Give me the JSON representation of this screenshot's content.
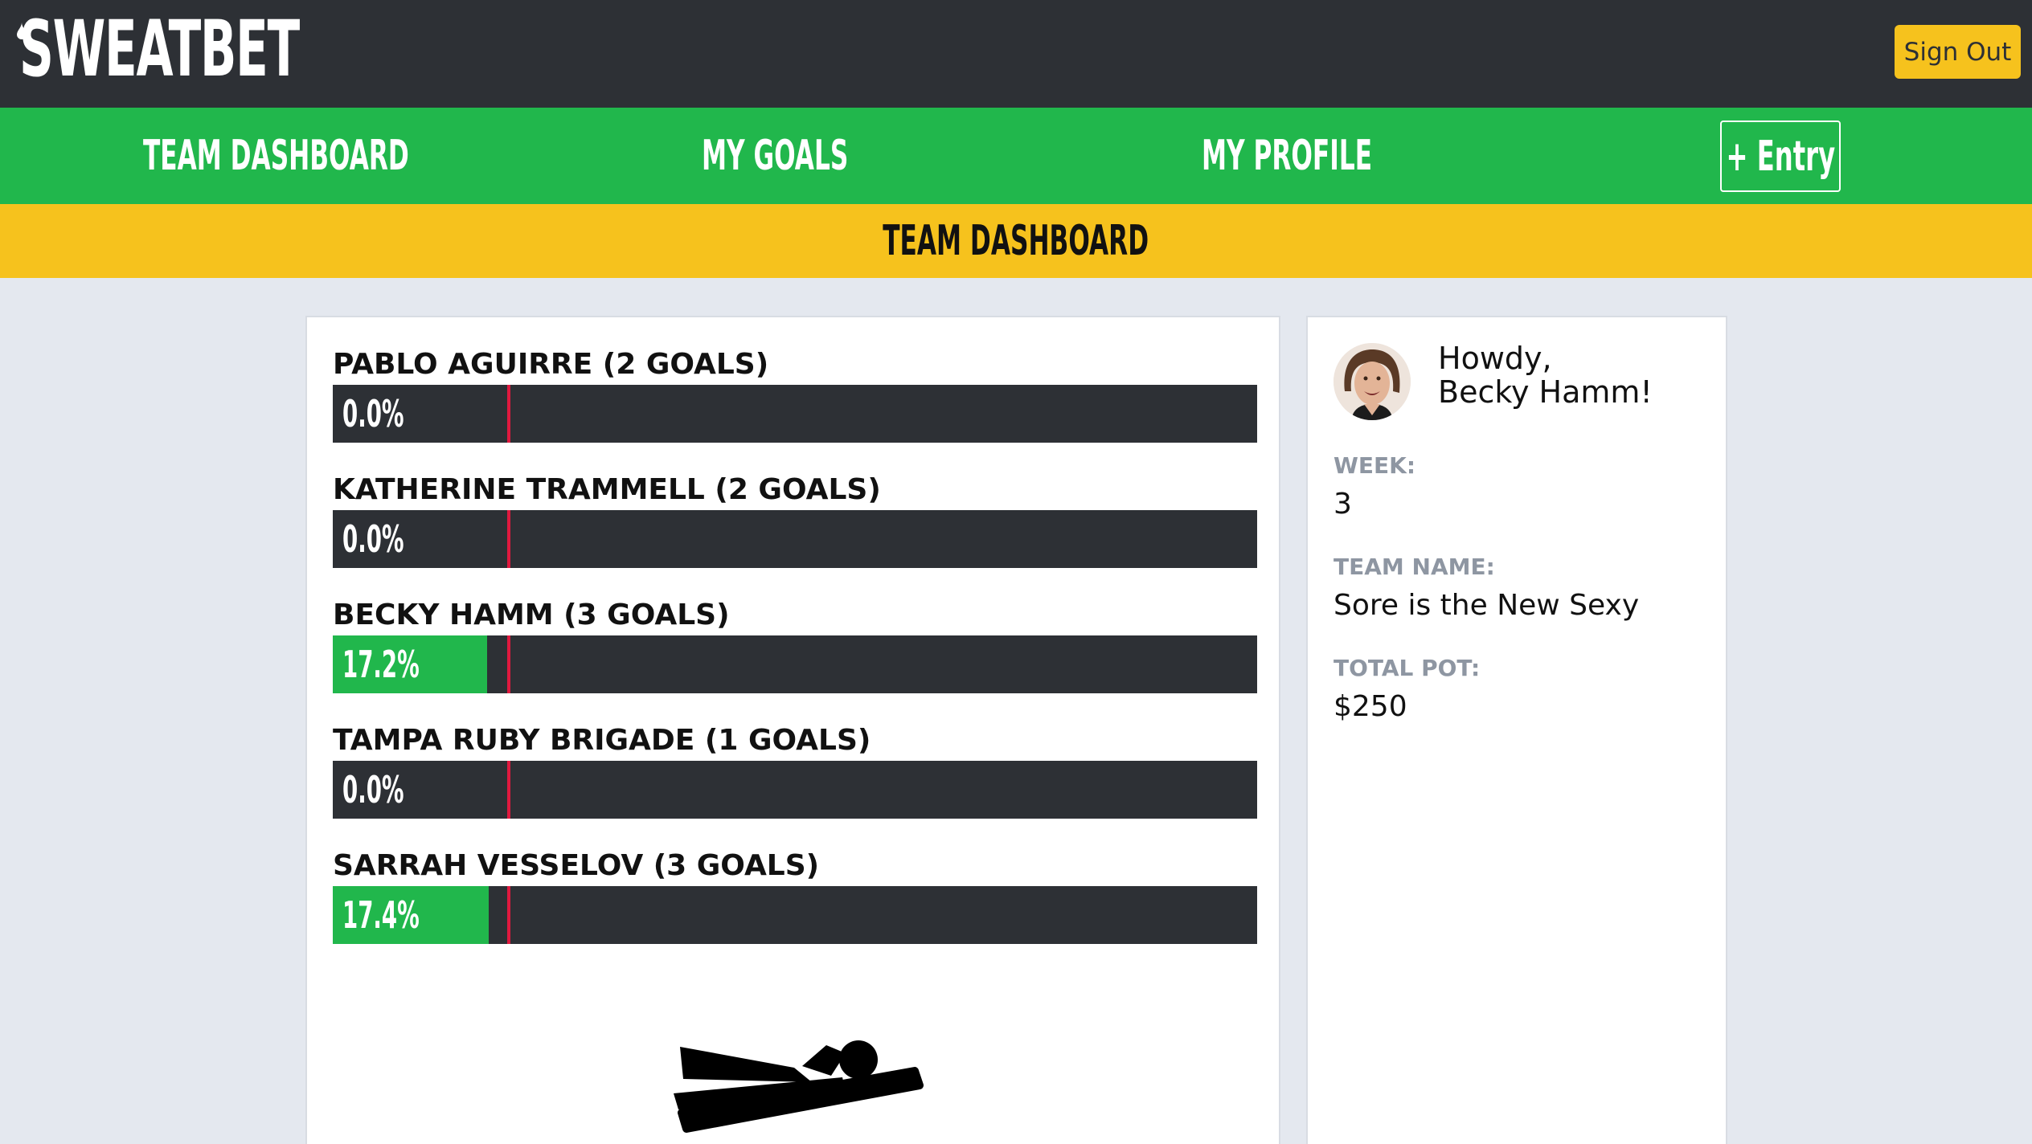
{
  "app": {
    "logo_text": "SWEATBET",
    "sign_out_label": "Sign Out"
  },
  "nav": {
    "items": [
      {
        "label": "TEAM DASHBOARD"
      },
      {
        "label": "MY GOALS"
      },
      {
        "label": "MY PROFILE"
      }
    ],
    "entry_label": "+ Entry"
  },
  "banner": {
    "title": "TEAM DASHBOARD"
  },
  "members": [
    {
      "name": "PABLO AGUIRRE (2 GOALS)",
      "progress_label": "0.0%",
      "progress": 0.0
    },
    {
      "name": "KATHERINE TRAMMELL (2 GOALS)",
      "progress_label": "0.0%",
      "progress": 0.0
    },
    {
      "name": "BECKY HAMM (3 GOALS)",
      "progress_label": "17.2%",
      "progress": 17.2
    },
    {
      "name": "TAMPA RUBY BRIGADE (1 GOALS)",
      "progress_label": "0.0%",
      "progress": 0.0
    },
    {
      "name": "SARRAH VESSELOV (3 GOALS)",
      "progress_label": "17.4%",
      "progress": 17.4
    }
  ],
  "sidebar": {
    "greeting_line1": "Howdy,",
    "greeting_line2": "Becky Hamm!",
    "week_label": "WEEK:",
    "week_value": "3",
    "team_name_label": "TEAM NAME:",
    "team_name_value": "Sore is the New Sexy",
    "total_pot_label": "TOTAL POT:",
    "total_pot_value": "$250"
  },
  "icons": {
    "logo_drop": "water-drop-icon",
    "figure": "lying-person-icon",
    "avatar": "user-photo"
  },
  "colors": {
    "header_bg": "#2d3035",
    "nav_green": "#21b74c",
    "banner_yellow": "#f6c21d",
    "page_bg": "#e4e8ef",
    "bar_track": "#2d3035",
    "bar_fill": "#21b74c",
    "bar_marker": "#e0193f",
    "muted_label": "#8e96a2"
  }
}
